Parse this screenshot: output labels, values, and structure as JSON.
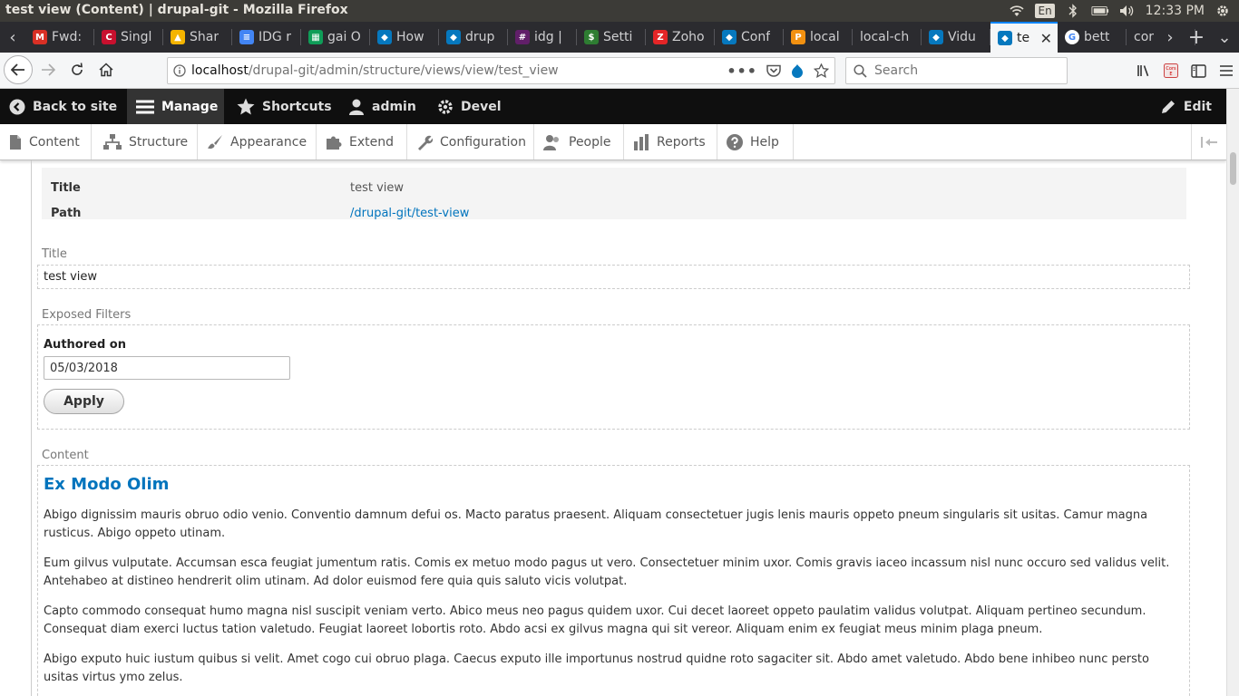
{
  "os": {
    "window_title": "test view (Content) | drupal-git - Mozilla Firefox",
    "lang": "En",
    "time": "12:33 PM"
  },
  "tabs": [
    {
      "label": "Fwd:",
      "favicon": "gmail-icon",
      "color": "#d93025",
      "glyph": "M"
    },
    {
      "label": "Singl",
      "favicon": "codeigniter-icon",
      "color": "#c8102e",
      "glyph": "C"
    },
    {
      "label": "Shar",
      "favicon": "google-drive-icon",
      "color": "#f4b400",
      "glyph": "▲"
    },
    {
      "label": "IDG r",
      "favicon": "google-docs-icon",
      "color": "#4285f4",
      "glyph": "≡"
    },
    {
      "label": "gai O",
      "favicon": "google-sheets-icon",
      "color": "#0f9d58",
      "glyph": "▦"
    },
    {
      "label": "How",
      "favicon": "drupal-icon",
      "color": "#0678be",
      "glyph": "◆"
    },
    {
      "label": "drup",
      "favicon": "drupal-icon",
      "color": "#0678be",
      "glyph": "◆"
    },
    {
      "label": "idg |",
      "favicon": "slack-icon",
      "color": "#611f69",
      "glyph": "#"
    },
    {
      "label": "Setti",
      "favicon": "dollar-icon",
      "color": "#2e7d32",
      "glyph": "$"
    },
    {
      "label": "Zoho",
      "favicon": "zoho-icon",
      "color": "#e42527",
      "glyph": "Z"
    },
    {
      "label": "Conf",
      "favicon": "drupal-icon",
      "color": "#0678be",
      "glyph": "◆"
    },
    {
      "label": "local",
      "favicon": "pma-icon",
      "color": "#f29111",
      "glyph": "P"
    },
    {
      "label": "local-ch",
      "favicon": "",
      "color": "#2b2b2f",
      "glyph": ""
    },
    {
      "label": "Vidu",
      "favicon": "drupal-icon",
      "color": "#0678be",
      "glyph": "◆"
    },
    {
      "label": "te",
      "favicon": "drupal-icon",
      "color": "#0678be",
      "glyph": "◆",
      "active": true
    },
    {
      "label": "bett",
      "favicon": "google-icon",
      "color": "#ffffff",
      "glyph": "G"
    },
    {
      "label": "cor",
      "favicon": "",
      "color": "#2b2b2f",
      "glyph": ""
    }
  ],
  "nav": {
    "url_host": "localhost",
    "url_path": "/drupal-git/admin/structure/views/view/test_view",
    "search_placeholder": "Search"
  },
  "toolbar": {
    "back_to_site": "Back to site",
    "manage": "Manage",
    "shortcuts": "Shortcuts",
    "user": "admin",
    "devel": "Devel",
    "edit": "Edit"
  },
  "tray": {
    "content": "Content",
    "structure": "Structure",
    "appearance": "Appearance",
    "extend": "Extend",
    "configuration": "Configuration",
    "people": "People",
    "reports": "Reports",
    "help": "Help"
  },
  "summary": {
    "title_key": "Title",
    "title_value": "test view",
    "path_key": "Path",
    "path_value": "/drupal-git/test-view"
  },
  "preview": {
    "title_label": "Title",
    "title_value": "test view",
    "filters_label": "Exposed Filters",
    "authored_label": "Authored on",
    "authored_value": "05/03/2018",
    "apply": "Apply",
    "content_label": "Content",
    "node_title": "Ex Modo Olim",
    "paragraphs": [
      "Abigo dignissim mauris obruo odio venio. Conventio damnum defui os. Macto paratus praesent. Aliquam consectetuer jugis lenis mauris oppeto pneum singularis sit usitas. Camur magna rusticus. Abigo oppeto utinam.",
      "Eum gilvus vulputate. Accumsan esca feugiat jumentum ratis. Comis ex metuo modo pagus ut vero. Consectetuer minim uxor. Comis gravis iaceo incassum nisl nunc occuro sed validus velit. Antehabeo at distineo hendrerit olim utinam. Ad dolor euismod fere quia quis saluto vicis volutpat.",
      "Capto commodo consequat humo magna nisl suscipit veniam verto. Abico meus neo pagus quidem uxor. Cui decet laoreet oppeto paulatim validus volutpat. Aliquam pertineo secundum. Consequat diam exerci luctus tation valetudo. Feugiat laoreet lobortis roto. Abdo acsi ex gilvus magna qui sit vereor. Aliquam enim ex feugiat meus minim plaga pneum.",
      "Abigo exputo huic iustum quibus si velit. Amet cogo cui obruo plaga. Caecus exputo ille importunus nostrud quidne roto sagaciter sit. Abdo amet valetudo. Abdo bene inhibeo nunc persto usitas virtus ymo zelus."
    ]
  }
}
